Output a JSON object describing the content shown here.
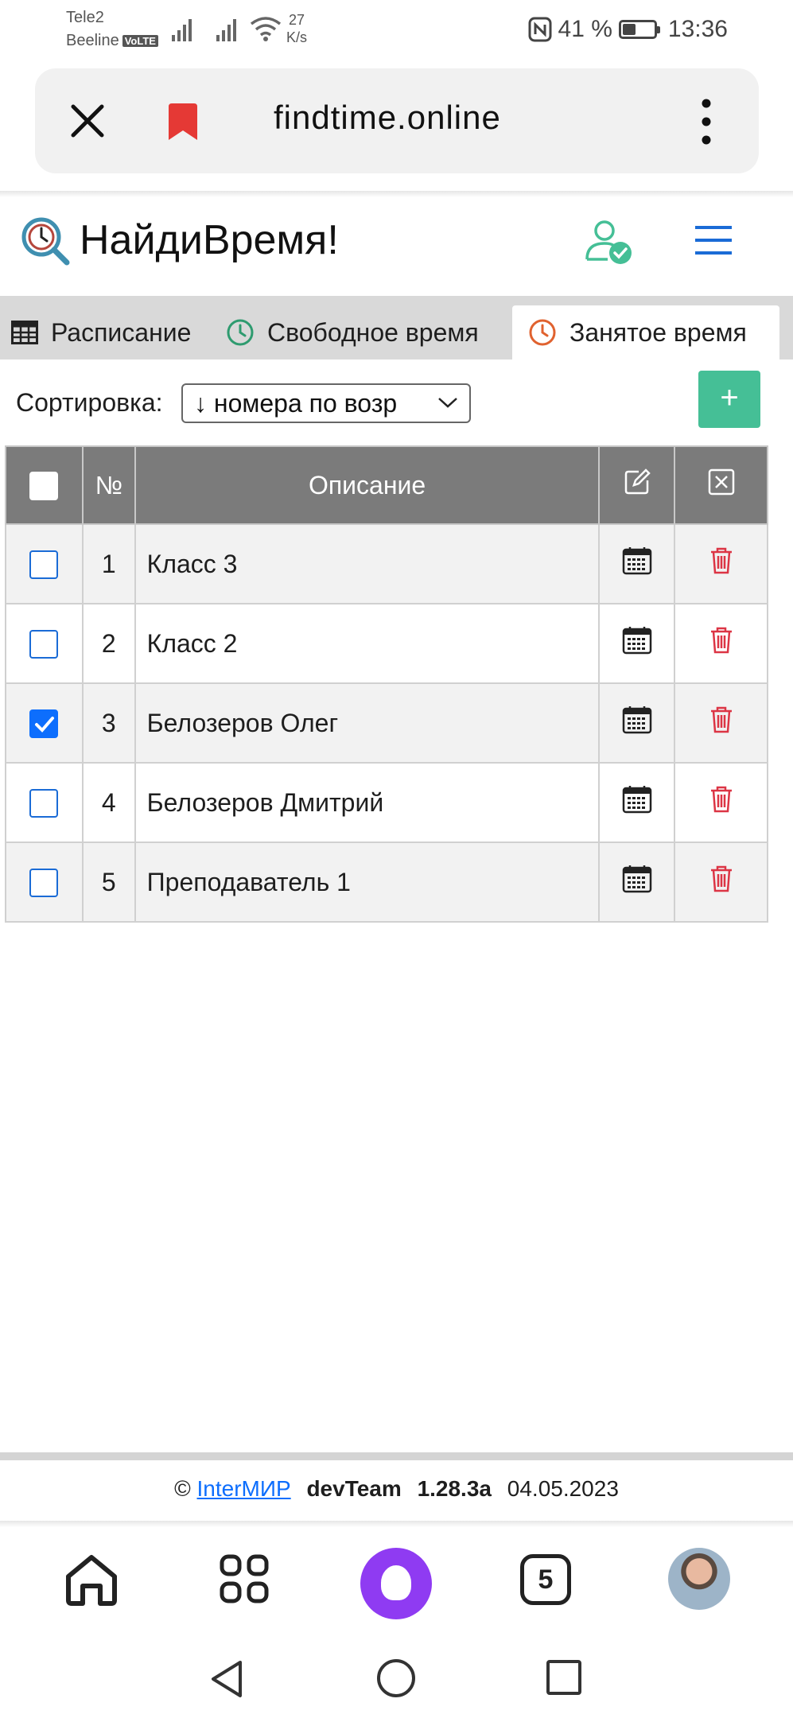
{
  "status_bar": {
    "carrier1": "Tele2",
    "carrier2": "Beeline",
    "volte": "VoLTE",
    "speed_value": "27",
    "speed_unit": "K/s",
    "battery": "41 %",
    "time": "13:36"
  },
  "browser": {
    "url": "findtime.online"
  },
  "header": {
    "title": "НайдиВремя!"
  },
  "tabs": [
    {
      "label": "Расписание"
    },
    {
      "label": "Свободное время"
    },
    {
      "label": "Занятое время"
    }
  ],
  "sort": {
    "label": "Сортировка:",
    "selected": "↓ номера по возр",
    "add_label": "+"
  },
  "table": {
    "headers": {
      "num": "№",
      "desc": "Описание"
    },
    "rows": [
      {
        "num": "1",
        "desc": "Класс 3",
        "checked": false
      },
      {
        "num": "2",
        "desc": "Класс 2",
        "checked": false
      },
      {
        "num": "3",
        "desc": "Белозеров Олег",
        "checked": true
      },
      {
        "num": "4",
        "desc": "Белозеров Дмитрий",
        "checked": false
      },
      {
        "num": "5",
        "desc": "Преподаватель 1",
        "checked": false
      }
    ]
  },
  "footer": {
    "copyright": "©",
    "link": "InterМИР",
    "team": "devTeam",
    "version": "1.28.3a",
    "date": "04.05.2023"
  },
  "bottom_nav": {
    "tabs_count": "5"
  },
  "colors": {
    "accent_green": "#45bf96",
    "header_gray": "#7b7b7b",
    "delete_red": "#dc3545",
    "checkbox_blue": "#0d6efd",
    "bookmark_red": "#e53935"
  }
}
